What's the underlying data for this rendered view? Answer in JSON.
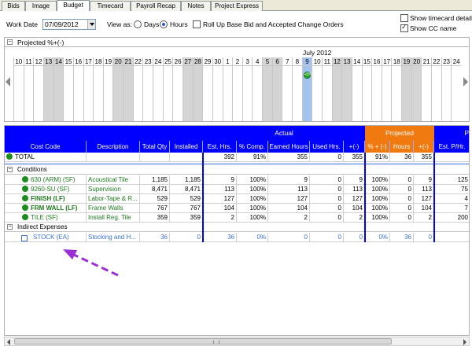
{
  "tabs": [
    "Bids",
    "Image",
    "Budget",
    "Timecard",
    "Payroll Recap",
    "Notes",
    "Project Express"
  ],
  "active_tab": "Budget",
  "toolbar": {
    "work_date_label": "Work Date",
    "work_date_value": "07/09/2012",
    "view_as_label": "View as:",
    "days_label": "Days",
    "hours_label": "Hours",
    "selected_view": "Hours",
    "rollup_label": "Roll Up Base Bid and Accepted Change Orders",
    "rollup_checked": false,
    "show_timecard_label": "Show timecard detail",
    "show_timecard_checked": false,
    "show_cc_label": "Show CC name",
    "show_cc_checked": true
  },
  "projected_panel": {
    "title": "Projected %+(-)",
    "month_label": "July 2012",
    "days": [
      "10",
      "11",
      "12",
      "13",
      "14",
      "15",
      "16",
      "17",
      "18",
      "19",
      "20",
      "21",
      "22",
      "23",
      "24",
      "25",
      "26",
      "27",
      "28",
      "29",
      "30",
      "1",
      "2",
      "3",
      "4",
      "5",
      "6",
      "7",
      "8",
      "9",
      "10",
      "11",
      "12",
      "13",
      "14",
      "15",
      "16",
      "17",
      "18",
      "19",
      "20",
      "21",
      "22",
      "23",
      "24"
    ],
    "weekend_days_index": [
      3,
      4,
      10,
      11,
      17,
      18,
      25,
      26,
      32,
      33,
      39,
      40
    ],
    "selected_day_index": 29,
    "badge_label": "+5%"
  },
  "grid": {
    "group_headers": {
      "actual": "Actual",
      "projected": "Projected",
      "p": "P"
    },
    "columns": [
      "Cost Code",
      "Description",
      "Total Qty",
      "Installed Qty",
      "Est. Hrs.",
      "% Comp.",
      "Earned Hours",
      "Used Hrs.",
      "+(-)",
      "% + (-)",
      "Hours",
      "+(-)",
      "Est. P/Hr."
    ],
    "total": {
      "label": "TOTAL",
      "est_hrs": "392",
      "comp": "91%",
      "earned": "355",
      "used": "0",
      "diff": "355",
      "proj_pct": "91%",
      "proj_hours": "36",
      "proj_diff": "355"
    },
    "groups": [
      {
        "name": "Conditions",
        "rows": [
          {
            "code": "630 (ARM) (SF)",
            "desc": "Acoustical Tile",
            "total_qty": "1,185",
            "installed": "1,185",
            "est": "9",
            "comp": "100%",
            "earned": "9",
            "used": "0",
            "diff": "9",
            "ppct": "100%",
            "phours": "0",
            "pdiff": "9",
            "p_hr": "125",
            "bold": false
          },
          {
            "code": "9260-SU (SF)",
            "desc": "Supervision",
            "total_qty": "8,471",
            "installed": "8,471",
            "est": "113",
            "comp": "100%",
            "earned": "113",
            "used": "0",
            "diff": "113",
            "ppct": "100%",
            "phours": "0",
            "pdiff": "113",
            "p_hr": "75",
            "bold": false
          },
          {
            "code": "FINISH (LF)",
            "desc": "Labor-Tape & R...",
            "total_qty": "529",
            "installed": "529",
            "est": "127",
            "comp": "100%",
            "earned": "127",
            "used": "0",
            "diff": "127",
            "ppct": "100%",
            "phours": "0",
            "pdiff": "127",
            "p_hr": "4",
            "bold": true
          },
          {
            "code": "FRM WALL (LF)",
            "desc": "Frame Walls",
            "total_qty": "767",
            "installed": "767",
            "est": "104",
            "comp": "100%",
            "earned": "104",
            "used": "0",
            "diff": "104",
            "ppct": "100%",
            "phours": "0",
            "pdiff": "104",
            "p_hr": "7",
            "bold": true
          },
          {
            "code": "TILE (SF)",
            "desc": "Install Reg. Tile",
            "total_qty": "359",
            "installed": "359",
            "est": "2",
            "comp": "100%",
            "earned": "2",
            "used": "0",
            "diff": "2",
            "ppct": "100%",
            "phours": "0",
            "pdiff": "2",
            "p_hr": "200",
            "bold": false
          }
        ]
      },
      {
        "name": "Indirect Expenses",
        "rows": [
          {
            "code": "STOCK (EA)",
            "desc": "Stocking and H...",
            "total_qty": "36",
            "installed": "0",
            "est": "36",
            "comp": "0%",
            "earned": "0",
            "used": "0",
            "diff": "0",
            "ppct": "0%",
            "phours": "36",
            "pdiff": "0",
            "p_hr": "",
            "bold": false
          }
        ]
      }
    ]
  },
  "colors": {
    "header_blue": "#0000ff",
    "projected_orange": "#f07a10",
    "status_green": "#1c8c1c",
    "annotation_purple": "#9b2fd6"
  }
}
